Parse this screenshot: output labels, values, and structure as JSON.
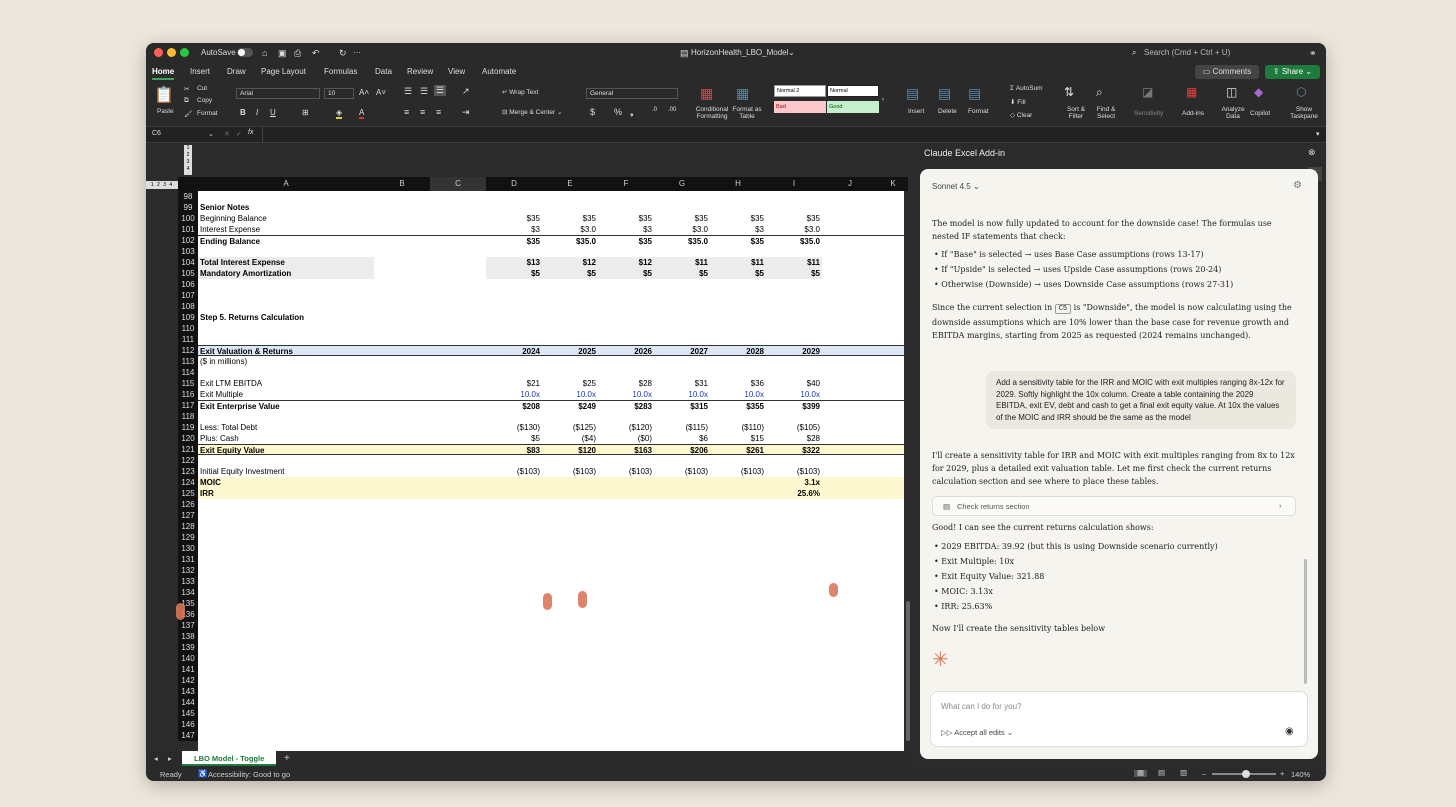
{
  "window": {
    "title": "HorizonHealth_LBO_Model",
    "autosave": "AutoSave",
    "search_placeholder": "Search (Cmd + Ctrl + U)"
  },
  "menu": {
    "tabs": [
      "Home",
      "Insert",
      "Draw",
      "Page Layout",
      "Formulas",
      "Data",
      "Review",
      "View",
      "Automate"
    ],
    "comments": "Comments",
    "share": "Share"
  },
  "ribbon": {
    "paste": "Paste",
    "cut": "Cut",
    "copy": "Copy",
    "format": "Format",
    "font": "Arial",
    "size": "10",
    "wrap_text": "Wrap Text",
    "merge_center": "Merge & Center",
    "number_format": "General",
    "conditional": "Conditional Formatting",
    "format_table": "Format as Table",
    "styles": [
      "Normal 2",
      "Normal",
      "Bad",
      "Good"
    ],
    "insert": "Insert",
    "delete": "Delete",
    "format_cells": "Format",
    "autosum": "AutoSum",
    "fill": "Fill",
    "clear": "Clear",
    "sort_filter": "Sort & Filter",
    "find_select": "Find & Select",
    "sensitivity": "Sensitivity",
    "addins": "Add-ins",
    "analyze": "Analyze Data",
    "copilot": "Copilot",
    "taskpane": "Show Taskpane"
  },
  "formula_bar": {
    "cell": "C6",
    "fx": "fx"
  },
  "columns": [
    "A",
    "B",
    "C",
    "D",
    "E",
    "F",
    "G",
    "H",
    "I",
    "J",
    "K"
  ],
  "outline_levels": [
    "1",
    "2",
    "3",
    "4"
  ],
  "rows": [
    {
      "n": "98",
      "a": "",
      "vals": [
        "",
        "",
        "",
        "",
        "",
        ""
      ]
    },
    {
      "n": "99",
      "a": "Senior Notes",
      "bold": true,
      "vals": [
        "",
        "",
        "",
        "",
        "",
        ""
      ]
    },
    {
      "n": "100",
      "a": "  Beginning Balance",
      "vals": [
        "$35",
        "$35",
        "$35",
        "$35",
        "$35",
        "$35"
      ]
    },
    {
      "n": "101",
      "a": "  Interest Expense",
      "vals": [
        "$3",
        "$3.0",
        "$3",
        "$3.0",
        "$3",
        "$3.0"
      ]
    },
    {
      "n": "102",
      "a": "  Ending Balance",
      "bold": true,
      "vals": [
        "$35",
        "$35.0",
        "$35",
        "$35.0",
        "$35",
        "$35.0"
      ]
    },
    {
      "n": "103",
      "a": "",
      "vals": [
        "",
        "",
        "",
        "",
        "",
        ""
      ]
    },
    {
      "n": "104",
      "a": "Total Interest Expense",
      "bold": true,
      "vals": [
        "$13",
        "$12",
        "$12",
        "$11",
        "$11",
        "$11"
      ]
    },
    {
      "n": "105",
      "a": "Mandatory Amortization",
      "bold": true,
      "vals": [
        "$5",
        "$5",
        "$5",
        "$5",
        "$5",
        "$5"
      ]
    },
    {
      "n": "106",
      "a": "",
      "vals": [
        "",
        "",
        "",
        "",
        "",
        ""
      ]
    },
    {
      "n": "107",
      "a": "",
      "vals": [
        "",
        "",
        "",
        "",
        "",
        ""
      ]
    },
    {
      "n": "108",
      "a": "",
      "vals": [
        "",
        "",
        "",
        "",
        "",
        ""
      ]
    },
    {
      "n": "109",
      "a": "Step 5. Returns Calculation",
      "bold": true,
      "vals": [
        "",
        "",
        "",
        "",
        "",
        ""
      ]
    },
    {
      "n": "110",
      "a": "",
      "vals": [
        "",
        "",
        "",
        "",
        "",
        ""
      ]
    },
    {
      "n": "111",
      "a": "",
      "vals": [
        "",
        "",
        "",
        "",
        "",
        ""
      ]
    },
    {
      "n": "112",
      "a": "Exit Valuation & Returns",
      "bold": true,
      "vals": [
        "2024",
        "2025",
        "2026",
        "2027",
        "2028",
        "2029"
      ]
    },
    {
      "n": "113",
      "a": "($ in millions)",
      "vals": [
        "",
        "",
        "",
        "",
        "",
        ""
      ]
    },
    {
      "n": "114",
      "a": "",
      "vals": [
        "",
        "",
        "",
        "",
        "",
        ""
      ]
    },
    {
      "n": "115",
      "a": "Exit LTM EBITDA",
      "vals": [
        "$21",
        "$25",
        "$28",
        "$31",
        "$36",
        "$40"
      ]
    },
    {
      "n": "116",
      "a": "Exit Multiple",
      "vals": [
        "10.0x",
        "10.0x",
        "10.0x",
        "10.0x",
        "10.0x",
        "10.0x"
      ]
    },
    {
      "n": "117",
      "a": "Exit Enterprise Value",
      "bold": true,
      "vals": [
        "$208",
        "$249",
        "$283",
        "$315",
        "$355",
        "$399"
      ]
    },
    {
      "n": "118",
      "a": "",
      "vals": [
        "",
        "",
        "",
        "",
        "",
        ""
      ]
    },
    {
      "n": "119",
      "a": "Less: Total Debt",
      "vals": [
        "($130)",
        "($125)",
        "($120)",
        "($115)",
        "($110)",
        "($105)"
      ]
    },
    {
      "n": "120",
      "a": "Plus: Cash",
      "vals": [
        "$5",
        "($4)",
        "($0)",
        "$6",
        "$15",
        "$28"
      ]
    },
    {
      "n": "121",
      "a": "Exit Equity Value",
      "bold": true,
      "vals": [
        "$83",
        "$120",
        "$163",
        "$206",
        "$261",
        "$322"
      ]
    },
    {
      "n": "122",
      "a": "",
      "vals": [
        "",
        "",
        "",
        "",
        "",
        ""
      ]
    },
    {
      "n": "123",
      "a": "Initial Equity Investment",
      "vals": [
        "($103)",
        "($103)",
        "($103)",
        "($103)",
        "($103)",
        "($103)"
      ]
    },
    {
      "n": "124",
      "a": "MOIC",
      "bold": true,
      "vals": [
        "",
        "",
        "",
        "",
        "",
        "3.1x"
      ]
    },
    {
      "n": "125",
      "a": "IRR",
      "bold": true,
      "vals": [
        "",
        "",
        "",
        "",
        "",
        "25.6%"
      ]
    },
    {
      "n": "126",
      "a": "",
      "vals": [
        "",
        "",
        "",
        "",
        "",
        ""
      ]
    },
    {
      "n": "127",
      "a": "",
      "vals": [
        "",
        "",
        "",
        "",
        "",
        ""
      ]
    },
    {
      "n": "128",
      "a": "",
      "vals": [
        "",
        "",
        "",
        "",
        "",
        ""
      ]
    },
    {
      "n": "129",
      "a": "",
      "vals": [
        "",
        "",
        "",
        "",
        "",
        ""
      ]
    },
    {
      "n": "130",
      "a": "",
      "vals": [
        "",
        "",
        "",
        "",
        "",
        ""
      ]
    },
    {
      "n": "131",
      "a": "",
      "vals": [
        "",
        "",
        "",
        "",
        "",
        ""
      ]
    },
    {
      "n": "132",
      "a": "",
      "vals": [
        "",
        "",
        "",
        "",
        "",
        ""
      ]
    },
    {
      "n": "133",
      "a": "",
      "vals": [
        "",
        "",
        "",
        "",
        "",
        ""
      ]
    },
    {
      "n": "134",
      "a": "",
      "vals": [
        "",
        "",
        "",
        "",
        "",
        ""
      ]
    },
    {
      "n": "135",
      "a": "",
      "vals": [
        "",
        "",
        "",
        "",
        "",
        ""
      ]
    },
    {
      "n": "136",
      "a": "",
      "vals": [
        "",
        "",
        "",
        "",
        "",
        ""
      ]
    },
    {
      "n": "137",
      "a": "",
      "vals": [
        "",
        "",
        "",
        "",
        "",
        ""
      ]
    },
    {
      "n": "138",
      "a": "",
      "vals": [
        "",
        "",
        "",
        "",
        "",
        ""
      ]
    },
    {
      "n": "139",
      "a": "",
      "vals": [
        "",
        "",
        "",
        "",
        "",
        ""
      ]
    },
    {
      "n": "140",
      "a": "",
      "vals": [
        "",
        "",
        "",
        "",
        "",
        ""
      ]
    },
    {
      "n": "141",
      "a": "",
      "vals": [
        "",
        "",
        "",
        "",
        "",
        ""
      ]
    },
    {
      "n": "142",
      "a": "",
      "vals": [
        "",
        "",
        "",
        "",
        "",
        ""
      ]
    },
    {
      "n": "143",
      "a": "",
      "vals": [
        "",
        "",
        "",
        "",
        "",
        ""
      ]
    },
    {
      "n": "144",
      "a": "",
      "vals": [
        "",
        "",
        "",
        "",
        "",
        ""
      ]
    },
    {
      "n": "145",
      "a": "",
      "vals": [
        "",
        "",
        "",
        "",
        "",
        ""
      ]
    },
    {
      "n": "146",
      "a": "",
      "vals": [
        "",
        "",
        "",
        "",
        "",
        ""
      ]
    },
    {
      "n": "147",
      "a": "",
      "vals": [
        "",
        "",
        "",
        "",
        "",
        ""
      ]
    }
  ],
  "sheet_tab": "LBO Model - Toggle",
  "status": {
    "ready": "Ready",
    "accessibility": "Accessibility: Good to go",
    "zoom": "140%"
  },
  "addin": {
    "title": "Claude Excel Add-in",
    "model": "Sonnet 4.5",
    "msg1": "The model is now fully updated to account for the downside case! The formulas use nested IF statements that check:",
    "bullets1": [
      "If \"Base\" is selected → uses Base Case assumptions (rows 13-17)",
      "If \"Upside\" is selected → uses Upside Case assumptions (rows 20-24)",
      "Otherwise (Downside) → uses Downside Case assumptions (rows 27-31)"
    ],
    "msg2_a": "Since the current selection in",
    "msg2_cell": "C5",
    "msg2_b": "is \"Downside\", the model is now calculating using the downside assumptions which are 10% lower than the base case for revenue growth and EBITDA margins, starting from 2025 as requested (2024 remains unchanged).",
    "user_msg": "Add a sensitivity table for the IRR and MOIC with exit multiples ranging 8x-12x for 2029. Softly highlight the 10x column. Create a table containing the 2029 EBITDA, exit EV, debt and cash to get a final exit equity value. At 10x the values of the MOIC and IRR should be the same as the model",
    "msg3": "I'll create a sensitivity table for IRR and MOIC with exit multiples ranging from 8x to 12x for 2029, plus a detailed exit valuation table. Let me first check the current returns calculation section and see where to place these tables.",
    "tool": "Check returns section",
    "msg4": "Good! I can see the current returns calculation shows:",
    "bullets2": [
      "2029 EBITDA: 39.92 (but this is using Downside scenario currently)",
      "Exit Multiple: 10x",
      "Exit Equity Value: 321.88",
      "MOIC: 3.13x",
      "IRR: 25.63%"
    ],
    "msg5": "Now I'll create the sensitivity tables below",
    "input_placeholder": "What can I do for you?",
    "accept": "Accept all edits"
  }
}
